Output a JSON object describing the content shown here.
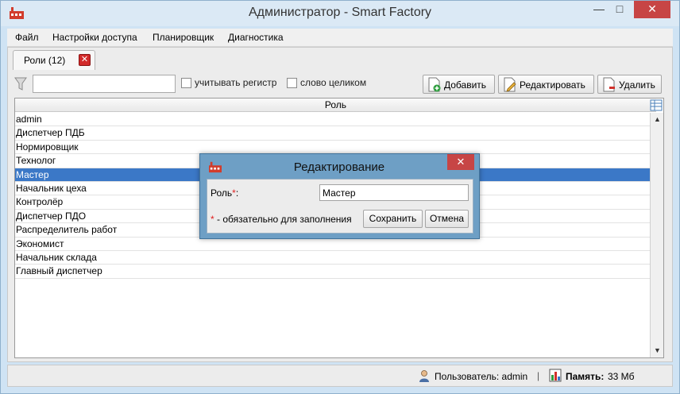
{
  "window": {
    "title": "Администратор - Smart Factory",
    "minimize": "—",
    "maximize": "□",
    "close": "✕"
  },
  "menu": [
    "Файл",
    "Настройки доступа",
    "Планировщик",
    "Диагностика"
  ],
  "tab": {
    "label": "Роли (12)",
    "close": "✕"
  },
  "toolbar": {
    "search_value": "",
    "case_label": "учитывать регистр",
    "whole_word_label": "слово целиком",
    "add_label": "Добавить",
    "edit_label": "Редактировать",
    "delete_label": "Удалить"
  },
  "table": {
    "header": "Роль",
    "rows": [
      "admin",
      "Диспетчер ПДБ",
      "Нормировщик",
      "Технолог",
      "Мастер",
      "Начальник цеха",
      "Контролёр",
      "Диспетчер ПДО",
      "Распределитель работ",
      "Экономист",
      "Начальник склада",
      "Главный диспетчер"
    ],
    "selected_index": 4,
    "scroll_up": "▲",
    "scroll_down": "▼"
  },
  "statusbar": {
    "user": "Пользователь: admin",
    "separator": "|",
    "memory_label": "Память:",
    "memory_value": "33 Мб"
  },
  "dialog": {
    "title": "Редактирование",
    "close": "✕",
    "field_label": "Роль",
    "required_mark": "*",
    "field_suffix": ":",
    "field_value": "Мастер",
    "note_star": "*",
    "note_text": " - обязательно для заполнения",
    "save_label": "Сохранить",
    "cancel_label": "Отмена"
  },
  "colors": {
    "selection": "#3b78c7",
    "close_red": "#c74545",
    "dialog_frame": "#6e9fc5",
    "required": "#e02020"
  }
}
